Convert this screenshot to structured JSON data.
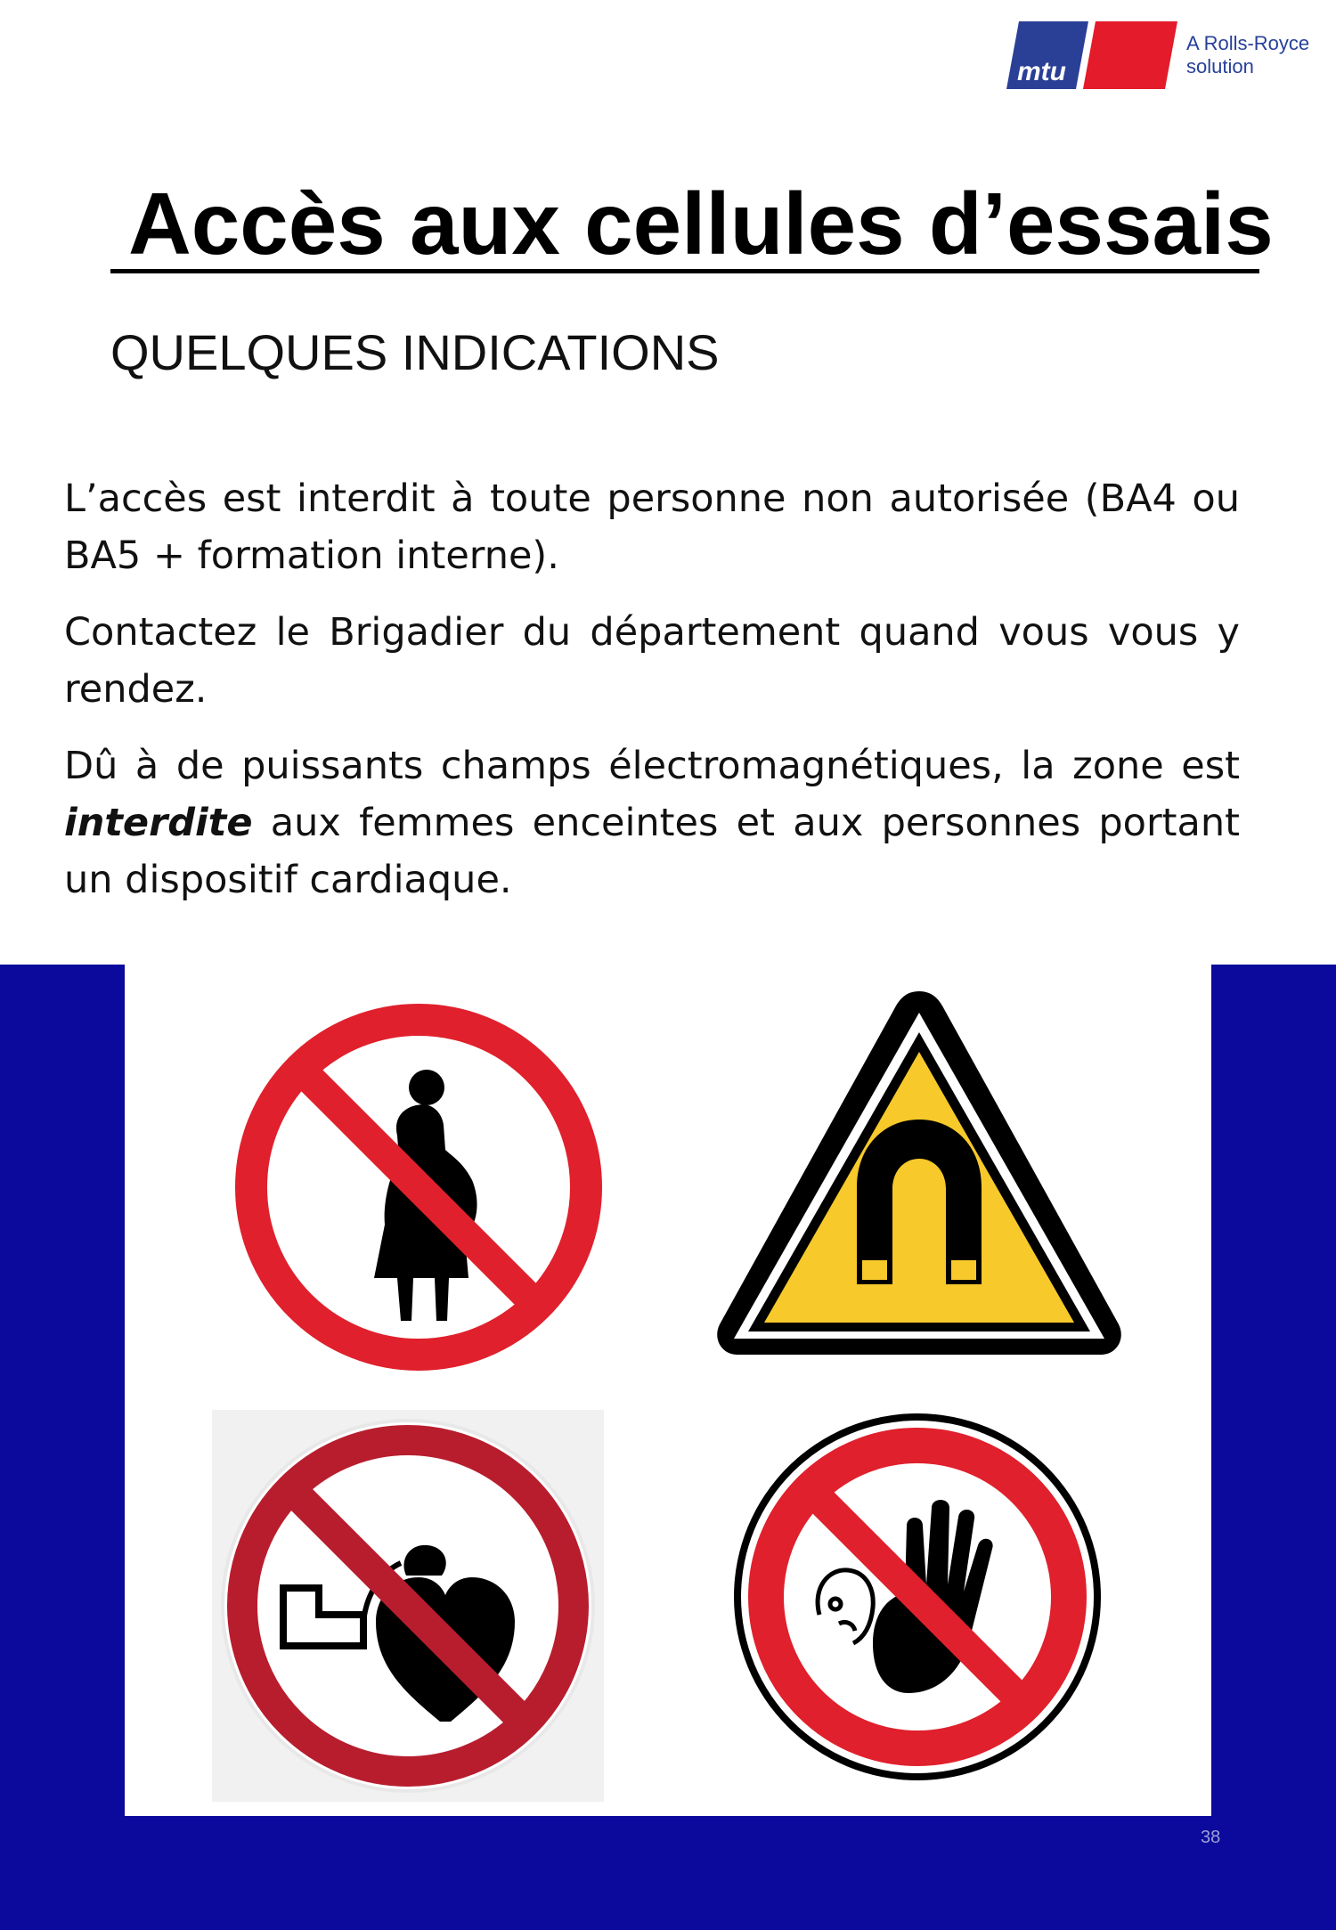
{
  "header": {
    "logo_text": "mtu",
    "logo_tagline_line1": "A Rolls-Royce",
    "logo_tagline_line2": "solution"
  },
  "title": "Accès aux cellules d’essais",
  "subtitle": "QUELQUES INDICATIONS",
  "paragraphs": [
    {
      "text": "L’accès est interdit à toute personne non autorisée (BA4 ou BA5 + formation interne)."
    },
    {
      "text": "Contactez le Brigadier du département quand vous vous y rendez."
    },
    {
      "before": "Dû à de puissants champs électromagnétiques, la zone est ",
      "emphasis": "interdite",
      "after": " aux femmes enceintes et aux personnes portant un dispositif cardiaque."
    }
  ],
  "signs": [
    {
      "name": "no-pregnant-women-sign",
      "icon": "pregnant-woman-prohibited-icon"
    },
    {
      "name": "magnetic-field-warning-sign",
      "icon": "magnet-warning-icon"
    },
    {
      "name": "no-pacemaker-sign",
      "icon": "pacemaker-prohibited-icon"
    },
    {
      "name": "no-unauthorized-access-sign",
      "icon": "stop-hand-prohibited-icon"
    }
  ],
  "colors": {
    "band": "#0c0a9c",
    "prohibition_red": "#e0202c",
    "warning_yellow": "#f7c92a",
    "logo_blue": "#27409a"
  },
  "page_number": "38"
}
